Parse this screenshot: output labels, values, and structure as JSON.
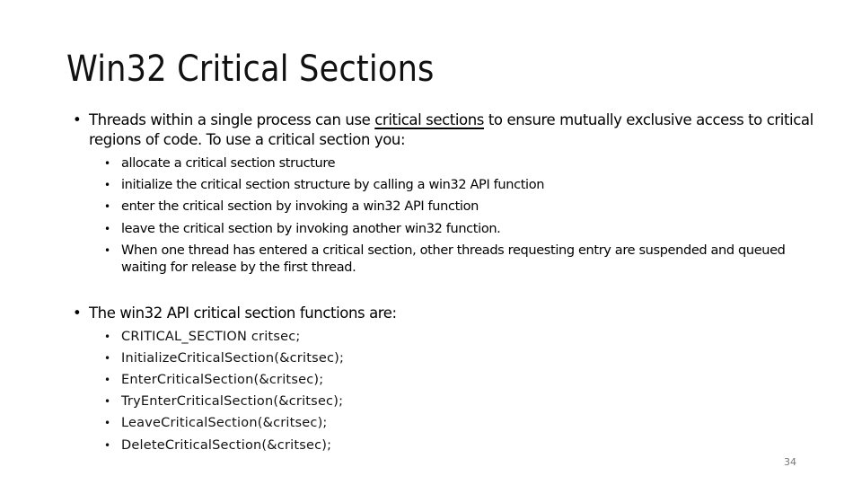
{
  "slide": {
    "title": "Win32 Critical Sections",
    "bullet_char": "•",
    "intro": {
      "before": "Threads within a single process can use ",
      "underlined": "critical sections",
      "after": " to ensure mutually exclusive access to critical regions of code.  To use a critical section you:"
    },
    "steps": [
      "allocate a critical section structure",
      "initialize the critical section structure by calling a win32 API function",
      "enter the critical section by invoking a win32 API function",
      "leave the critical section by invoking another win32 function.",
      "When one thread has entered a critical section, other threads requesting entry are suspended and queued waiting for release by the first thread."
    ],
    "functions_heading": "The win32 API critical section functions are:",
    "functions": [
      "CRITICAL_SECTION critsec;",
      "InitializeCriticalSection(&critsec);",
      "EnterCriticalSection(&critsec);",
      "TryEnterCriticalSection(&critsec);",
      "LeaveCriticalSection(&critsec);",
      "DeleteCriticalSection(&critsec);"
    ],
    "page_number": "34"
  }
}
